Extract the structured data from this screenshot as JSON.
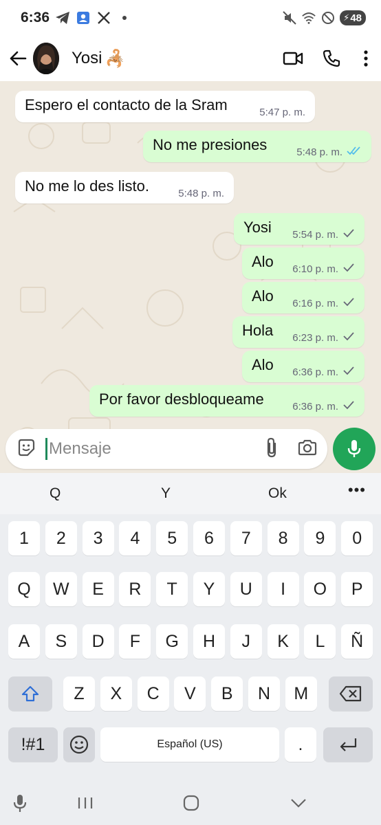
{
  "status_bar": {
    "time": "6:36",
    "left_icons": [
      "telegram-icon",
      "contacts-icon",
      "x-icon",
      "dot-icon"
    ],
    "right_icons": [
      "mute-icon",
      "wifi-icon",
      "blocked-icon"
    ],
    "battery": "48"
  },
  "header": {
    "contact_name": "Yosi",
    "contact_emoji": "🦂",
    "actions": [
      "video-call",
      "voice-call",
      "more-options"
    ]
  },
  "messages": [
    {
      "direction": "in",
      "text": "Espero el contacto de la Sram",
      "time": "5:47 p. m.",
      "status": ""
    },
    {
      "direction": "out",
      "text": "No me presiones",
      "time": "5:48 p. m.",
      "status": "read"
    },
    {
      "direction": "in",
      "text": "No me lo des listo.",
      "time": "5:48 p. m.",
      "status": ""
    },
    {
      "direction": "out",
      "text": "Yosi",
      "time": "5:54 p. m.",
      "status": "sent"
    },
    {
      "direction": "out",
      "text": "Alo",
      "time": "6:10 p. m.",
      "status": "sent"
    },
    {
      "direction": "out",
      "text": "Alo",
      "time": "6:16 p. m.",
      "status": "sent"
    },
    {
      "direction": "out",
      "text": "Hola",
      "time": "6:23 p. m.",
      "status": "sent"
    },
    {
      "direction": "out",
      "text": "Alo",
      "time": "6:36 p. m.",
      "status": "sent"
    },
    {
      "direction": "out",
      "text": "Por favor desbloqueame",
      "time": "6:36 p. m.",
      "status": "sent"
    }
  ],
  "composer": {
    "placeholder": "Mensaje",
    "value": ""
  },
  "keyboard": {
    "suggestions": [
      "Q",
      "Y",
      "Ok"
    ],
    "row_numbers": [
      "1",
      "2",
      "3",
      "4",
      "5",
      "6",
      "7",
      "8",
      "9",
      "0"
    ],
    "row1": [
      "Q",
      "W",
      "E",
      "R",
      "T",
      "Y",
      "U",
      "I",
      "O",
      "P"
    ],
    "row2": [
      "A",
      "S",
      "D",
      "F",
      "G",
      "H",
      "J",
      "K",
      "L",
      "Ñ"
    ],
    "row3": [
      "Z",
      "X",
      "C",
      "V",
      "B",
      "N",
      "M"
    ],
    "symbols_key": "!#1",
    "space_label": "Español (US)",
    "period_key": "."
  },
  "colors": {
    "chat_bg": "#efe9df",
    "outgoing_bubble": "#d9fdd3",
    "incoming_bubble": "#ffffff",
    "accent": "#21a558",
    "read_ticks": "#53bdeb"
  }
}
